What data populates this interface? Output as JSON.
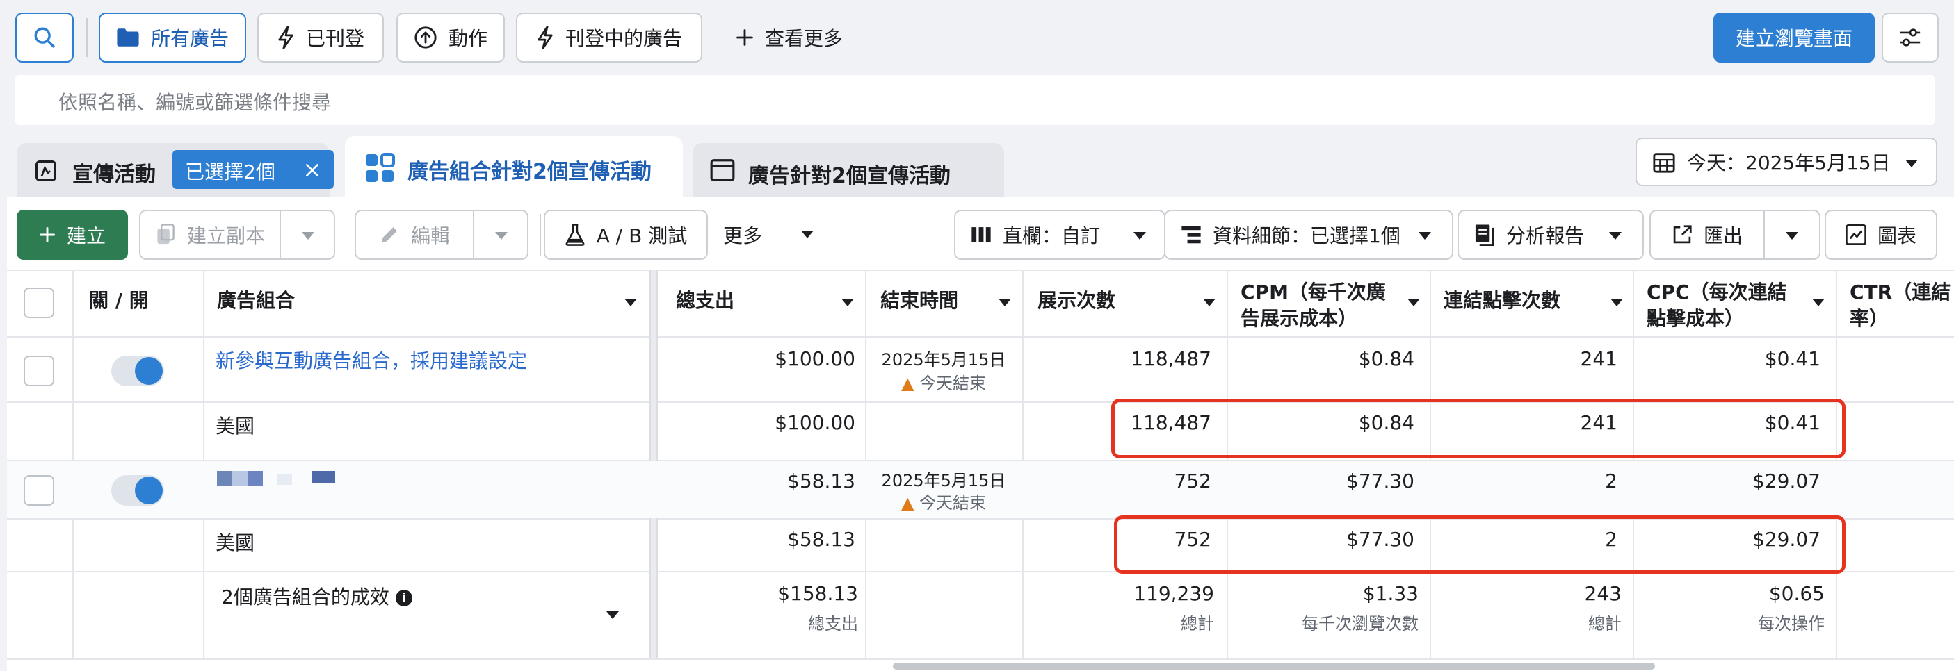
{
  "filters": {
    "all_ads": "所有廣告",
    "published": "已刊登",
    "actions": "動作",
    "active_ads": "刊登中的廣告",
    "see_more": "查看更多",
    "create_view": "建立瀏覽畫面"
  },
  "search": {
    "placeholder": "依照名稱、編號或篩選條件搜尋"
  },
  "tabs": {
    "campaigns": "宣傳活動",
    "selected_badge": "已選擇2個",
    "ad_sets": "廣告組合針對2個宣傳活動",
    "ads": "廣告針對2個宣傳活動"
  },
  "date_range": "今天：2025年5月15日",
  "toolbar": {
    "create": "建立",
    "duplicate": "建立副本",
    "edit": "編輯",
    "ab_test": "A / B 測試",
    "more": "更多",
    "columns": "直欄：自訂",
    "breakdown": "資料細節：已選擇1個",
    "reports": "分析報告",
    "export": "匯出",
    "charts": "圖表"
  },
  "table": {
    "headers": {
      "toggle": "關 / 開",
      "ad_set": "廣告組合",
      "spend": "總支出",
      "end_time": "結束時間",
      "impressions": "展示次數",
      "cpm_1": "CPM（每千次廣",
      "cpm_2": "告展示成本）",
      "clicks": "連結點擊次數",
      "cpc_1": "CPC（每次連結",
      "cpc_2": "點擊成本）",
      "ctr_1": "CTR（連結",
      "ctr_2": "率）"
    },
    "rows": [
      {
        "name": "新參與互動廣告組合，採用建議設定",
        "spend": "$100.00",
        "end_date": "2025年5月15日",
        "end_note": "今天結束",
        "impressions": "118,487",
        "cpm": "$0.84",
        "clicks": "241",
        "cpc": "$0.41"
      },
      {
        "name": "美國",
        "spend": "$100.00",
        "impressions": "118,487",
        "cpm": "$0.84",
        "clicks": "241",
        "cpc": "$0.41"
      },
      {
        "spend": "$58.13",
        "end_date": "2025年5月15日",
        "end_note": "今天結束",
        "impressions": "752",
        "cpm": "$77.30",
        "clicks": "2",
        "cpc": "$29.07"
      },
      {
        "name": "美國",
        "spend": "$58.13",
        "impressions": "752",
        "cpm": "$77.30",
        "clicks": "2",
        "cpc": "$29.07"
      }
    ],
    "summary": {
      "label": "2個廣告組合的成效",
      "spend": "$158.13",
      "spend_sub": "總支出",
      "impressions": "119,239",
      "impressions_sub": "總計",
      "cpm": "$1.33",
      "cpm_sub": "每千次瀏覽次數",
      "clicks": "243",
      "clicks_sub": "總計",
      "cpc": "$0.65",
      "cpc_sub": "每次操作"
    }
  },
  "colors": {
    "primary": "#2d7fd3",
    "create_green": "#2e7d52",
    "highlight": "#e5331f",
    "link": "#2b6acd"
  }
}
